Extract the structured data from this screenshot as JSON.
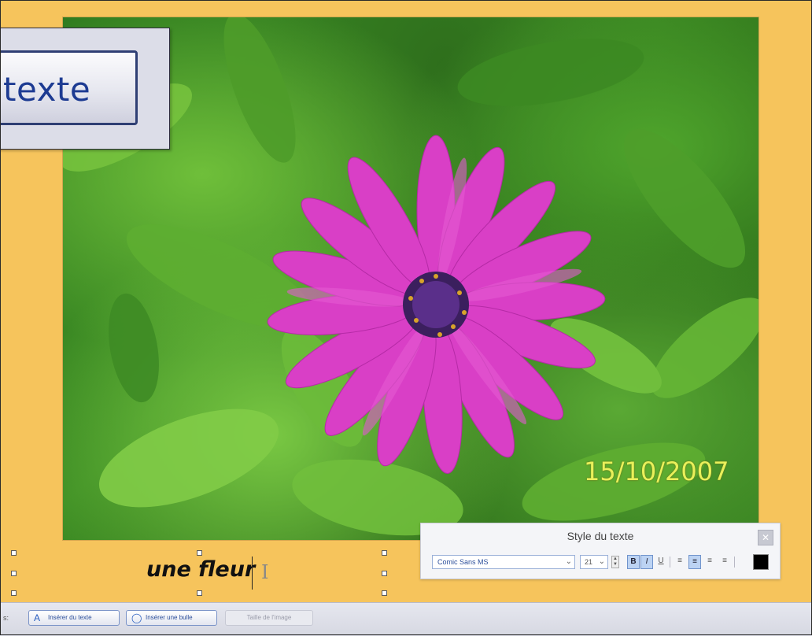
{
  "callout": {
    "zoomed_button_label": "texte"
  },
  "photo": {
    "date_stamp": "15/10/2007"
  },
  "caption": {
    "text": "une fleur"
  },
  "style_panel": {
    "title": "Style du texte",
    "close_icon": "close-icon",
    "font_family_value": "Comic Sans MS",
    "font_size_value": "21",
    "bold_label": "B",
    "italic_label": "I",
    "underline_label": "U",
    "align_left_label": "≡",
    "align_center_label": "≡",
    "align_right_label": "≡",
    "align_justify_label": "≡",
    "text_color": "#000000"
  },
  "bottom_toolbar": {
    "edge_text": "s:",
    "insert_text_button": "Insérer du texte",
    "insert_bubble_button": "Insérer une bulle",
    "image_size_button": "Taille de l'image"
  }
}
